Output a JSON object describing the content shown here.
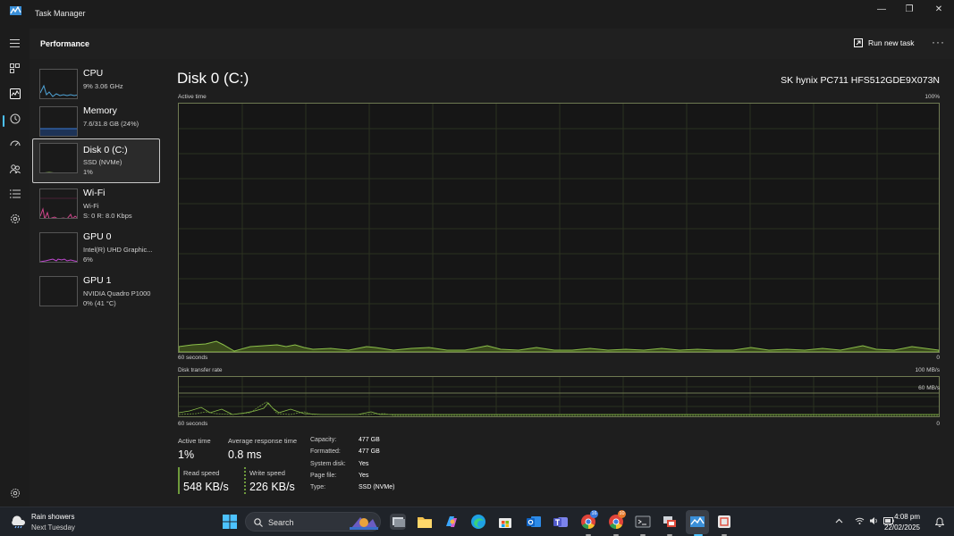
{
  "window": {
    "title": "Task Manager",
    "minimize_glyph": "—",
    "maximize_glyph": "❐",
    "close_glyph": "✕"
  },
  "header": {
    "title": "Performance",
    "run_new_task": "Run new task",
    "more_glyph": "···"
  },
  "devices": [
    {
      "name": "CPU",
      "line1": "9% 3.06 GHz",
      "line2": ""
    },
    {
      "name": "Memory",
      "line1": "7.6/31.8 GB (24%)",
      "line2": ""
    },
    {
      "name": "Disk 0 (C:)",
      "line1": "SSD (NVMe)",
      "line2": "1%"
    },
    {
      "name": "Wi-Fi",
      "line1": "Wi-Fi",
      "line2": "S: 0 R: 8.0 Kbps"
    },
    {
      "name": "GPU 0",
      "line1": "Intel(R) UHD Graphic...",
      "line2": "6%"
    },
    {
      "name": "GPU 1",
      "line1": "NVIDIA Quadro P1000",
      "line2": "0% (41 °C)"
    }
  ],
  "detail": {
    "title": "Disk 0 (C:)",
    "model": "SK hynix PC711 HFS512GDE9X073N",
    "active_time_label": "Active time",
    "active_time_max": "100%",
    "active_time_left": "60 seconds",
    "active_time_right": "0",
    "transfer_label": "Disk transfer rate",
    "transfer_max": "100 MB/s",
    "transfer_mid": "60 MB/s",
    "transfer_left": "60 seconds",
    "transfer_right": "0"
  },
  "stats": {
    "active_time_label": "Active time",
    "active_time_value": "1%",
    "avg_response_label": "Average response time",
    "avg_response_value": "0.8 ms",
    "read_label": "Read speed",
    "read_value": "548 KB/s",
    "write_label": "Write speed",
    "write_value": "226 KB/s"
  },
  "properties": [
    {
      "label": "Capacity:",
      "value": "477 GB"
    },
    {
      "label": "Formatted:",
      "value": "477 GB"
    },
    {
      "label": "System disk:",
      "value": "Yes"
    },
    {
      "label": "Page file:",
      "value": "Yes"
    },
    {
      "label": "Type:",
      "value": "SSD (NVMe)"
    }
  ],
  "taskbar": {
    "weather_line1": "Rain showers",
    "weather_line2": "Next Tuesday",
    "search_placeholder": "Search",
    "time": "4:08 pm",
    "date": "22/02/2025",
    "badge_1": "16",
    "badge_2": "10"
  },
  "colors": {
    "disk_line": "#8cc04a",
    "disk_fill": "#3a4a1c",
    "cpu_line": "#4fa3d6",
    "memory_line": "#3b7bd6",
    "wifi_line": "#d1468c",
    "gpu_line": "#c04ad1",
    "accent": "#4cc2ff"
  }
}
